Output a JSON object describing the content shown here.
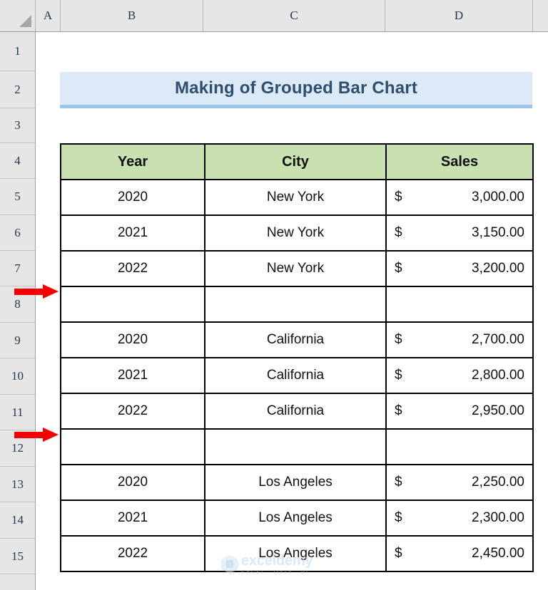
{
  "spreadsheet": {
    "column_headers": [
      "A",
      "B",
      "C",
      "D"
    ],
    "row_headers": [
      "1",
      "2",
      "3",
      "4",
      "5",
      "6",
      "7",
      "8",
      "9",
      "10",
      "11",
      "12",
      "13",
      "14",
      "15"
    ],
    "select_all_icon": "select-all-triangle-icon"
  },
  "title": {
    "text": "Making of Grouped Bar Chart",
    "fill_color": "#dce9f7",
    "underline_color": "#9dc3e6",
    "text_color": "#2f4f6f"
  },
  "table": {
    "header_fill": "#c9e0b0",
    "headers": [
      "Year",
      "City",
      "Sales"
    ],
    "rows": [
      {
        "year": "2020",
        "city": "New York",
        "currency": "$",
        "amount": "3,000.00",
        "blank": false
      },
      {
        "year": "2021",
        "city": "New York",
        "currency": "$",
        "amount": "3,150.00",
        "blank": false
      },
      {
        "year": "2022",
        "city": "New York",
        "currency": "$",
        "amount": "3,200.00",
        "blank": false
      },
      {
        "year": "",
        "city": "",
        "currency": "",
        "amount": "",
        "blank": true
      },
      {
        "year": "2020",
        "city": "California",
        "currency": "$",
        "amount": "2,700.00",
        "blank": false
      },
      {
        "year": "2021",
        "city": "California",
        "currency": "$",
        "amount": "2,800.00",
        "blank": false
      },
      {
        "year": "2022",
        "city": "California",
        "currency": "$",
        "amount": "2,950.00",
        "blank": false
      },
      {
        "year": "",
        "city": "",
        "currency": "",
        "amount": "",
        "blank": true
      },
      {
        "year": "2020",
        "city": "Los Angeles",
        "currency": "$",
        "amount": "2,250.00",
        "blank": false
      },
      {
        "year": "2021",
        "city": "Los Angeles",
        "currency": "$",
        "amount": "2,300.00",
        "blank": false
      },
      {
        "year": "2022",
        "city": "Los Angeles",
        "currency": "$",
        "amount": "2,450.00",
        "blank": false
      }
    ]
  },
  "annotations": {
    "arrow_color": "#f40000",
    "arrows": [
      {
        "name": "arrow-blank-row-8",
        "target_row": "8",
        "icon": "right-arrow-icon"
      },
      {
        "name": "arrow-blank-row-12",
        "target_row": "12",
        "icon": "right-arrow-icon"
      }
    ]
  },
  "watermark": {
    "name": "exceldemy",
    "tagline": "EXCEL · DATA · BI",
    "logo_icon": "exceldemy-hexagon-logo-icon"
  }
}
